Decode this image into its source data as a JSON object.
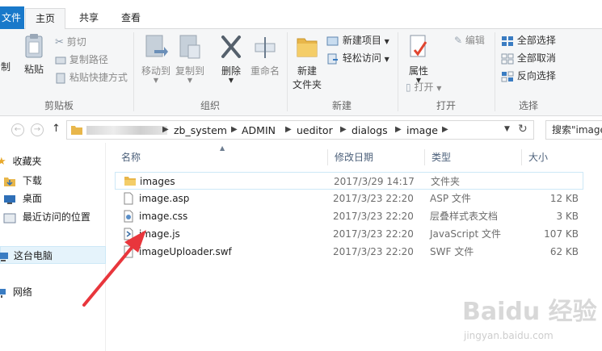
{
  "tabs": {
    "file": "文件",
    "home": "主页",
    "share": "共享",
    "view": "查看"
  },
  "ribbon": {
    "clipboard": {
      "label": "剪贴板",
      "pin_partial": "制",
      "paste": "粘贴",
      "cut": "剪切",
      "copy_path": "复制路径",
      "paste_shortcut": "粘贴快捷方式"
    },
    "organize": {
      "label": "组织",
      "move_to": "移动到",
      "copy_to": "复制到",
      "delete": "删除",
      "rename": "重命名"
    },
    "new": {
      "label": "新建",
      "new_folder_l1": "新建",
      "new_folder_l2": "文件夹",
      "new_item": "新建项目",
      "easy_access": "轻松访问"
    },
    "open": {
      "label": "打开",
      "properties": "属性",
      "open": "打开",
      "edit": "编辑"
    },
    "select": {
      "label": "选择",
      "select_all": "全部选择",
      "select_none": "全部取消",
      "invert": "反向选择"
    }
  },
  "address": {
    "crumbs": [
      "zb_system",
      "ADMIN",
      "ueditor",
      "dialogs",
      "image"
    ],
    "search_placeholder": "搜索\"image"
  },
  "nav": {
    "favorites": "收藏夹",
    "downloads": "下载",
    "desktop": "桌面",
    "recent": "最近访问的位置",
    "this_pc": "这台电脑",
    "network": "网络"
  },
  "columns": {
    "name": "名称",
    "date": "修改日期",
    "type": "类型",
    "size": "大小"
  },
  "files": [
    {
      "name": "images",
      "date": "2017/3/29 14:17",
      "type": "文件夹",
      "size": "",
      "icon": "folder-icon"
    },
    {
      "name": "image.asp",
      "date": "2017/3/23 22:20",
      "type": "ASP 文件",
      "size": "12 KB",
      "icon": "file-icon"
    },
    {
      "name": "image.css",
      "date": "2017/3/23 22:20",
      "type": "层叠样式表文档",
      "size": "3 KB",
      "icon": "css-file-icon"
    },
    {
      "name": "image.js",
      "date": "2017/3/23 22:20",
      "type": "JavaScript 文件",
      "size": "107 KB",
      "icon": "js-file-icon"
    },
    {
      "name": "imageUploader.swf",
      "date": "2017/3/23 22:20",
      "type": "SWF 文件",
      "size": "62 KB",
      "icon": "file-icon"
    }
  ],
  "watermark": {
    "brand": "Baidu 经验",
    "url": "jingyan.baidu.com"
  },
  "colors": {
    "accent": "#1979ca",
    "arrow": "#e8363c",
    "folder": "#e8b64a"
  }
}
